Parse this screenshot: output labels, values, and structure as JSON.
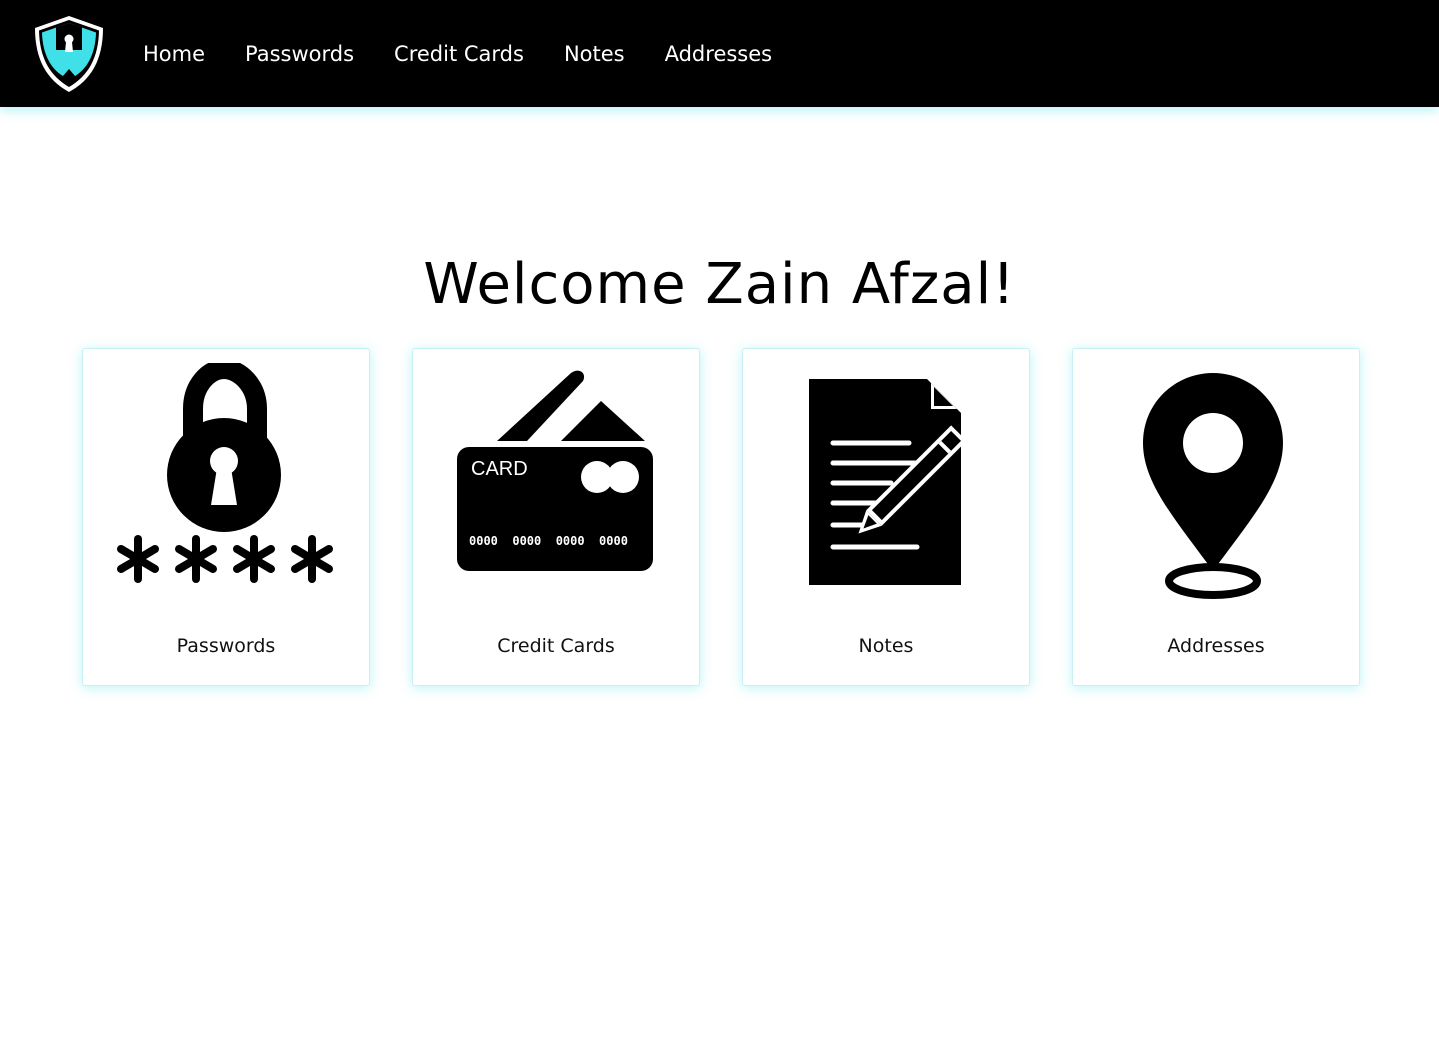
{
  "nav": {
    "logo_icon": "shield-lock-icon",
    "links": [
      {
        "label": "Home"
      },
      {
        "label": "Passwords"
      },
      {
        "label": "Credit Cards"
      },
      {
        "label": "Notes"
      },
      {
        "label": "Addresses"
      }
    ]
  },
  "main": {
    "welcome": "Welcome Zain Afzal!",
    "cards": [
      {
        "label": "Passwords",
        "icon": "padlock-password-icon"
      },
      {
        "label": "Credit Cards",
        "icon": "credit-card-icon",
        "card_text": "CARD",
        "card_number": "0000  0000  0000  0000"
      },
      {
        "label": "Notes",
        "icon": "document-pencil-icon"
      },
      {
        "label": "Addresses",
        "icon": "location-pin-icon"
      }
    ]
  },
  "colors": {
    "navbar_bg": "#000000",
    "accent": "#40E0E8",
    "text": "#111111"
  }
}
